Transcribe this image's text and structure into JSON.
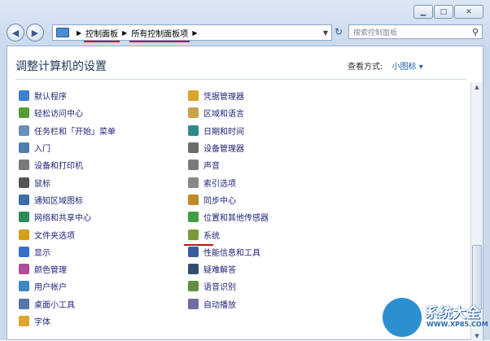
{
  "breadcrumb": [
    "控制面板",
    "所有控制面板项"
  ],
  "search": {
    "placeholder": "搜索控制面板"
  },
  "header": {
    "title": "调整计算机的设置",
    "view_by_label": "查看方式:",
    "view_by_value": "小图标 ▾"
  },
  "items_left": [
    {
      "label": "默认程序",
      "icon": "default-programs-icon"
    },
    {
      "label": "轻松访问中心",
      "icon": "ease-of-access-icon"
    },
    {
      "label": "任务栏和「开始」菜单",
      "icon": "taskbar-icon"
    },
    {
      "label": "入门",
      "icon": "getting-started-icon"
    },
    {
      "label": "设备和打印机",
      "icon": "printer-icon"
    },
    {
      "label": "鼠标",
      "icon": "mouse-icon"
    },
    {
      "label": "通知区域图标",
      "icon": "notification-icon"
    },
    {
      "label": "网络和共享中心",
      "icon": "network-icon"
    },
    {
      "label": "文件夹选项",
      "icon": "folder-icon"
    },
    {
      "label": "显示",
      "icon": "display-icon"
    },
    {
      "label": "颜色管理",
      "icon": "color-icon"
    },
    {
      "label": "用户帐户",
      "icon": "user-icon"
    },
    {
      "label": "桌面小工具",
      "icon": "gadgets-icon"
    },
    {
      "label": "字体",
      "icon": "font-icon"
    }
  ],
  "items_right": [
    {
      "label": "凭据管理器",
      "icon": "credential-icon"
    },
    {
      "label": "区域和语言",
      "icon": "region-icon"
    },
    {
      "label": "日期和时间",
      "icon": "clock-icon"
    },
    {
      "label": "设备管理器",
      "icon": "device-manager-icon"
    },
    {
      "label": "声音",
      "icon": "sound-icon"
    },
    {
      "label": "索引选项",
      "icon": "index-icon"
    },
    {
      "label": "同步中心",
      "icon": "sync-icon"
    },
    {
      "label": "位置和其他传感器",
      "icon": "location-icon"
    },
    {
      "label": "系统",
      "icon": "system-icon"
    },
    {
      "label": "性能信息和工具",
      "icon": "performance-icon"
    },
    {
      "label": "疑难解答",
      "icon": "troubleshoot-icon"
    },
    {
      "label": "语音识别",
      "icon": "speech-icon"
    },
    {
      "label": "自动播放",
      "icon": "autoplay-icon"
    }
  ],
  "watermark": {
    "text": "系统大全",
    "url": "WWW.XP85.COM"
  }
}
